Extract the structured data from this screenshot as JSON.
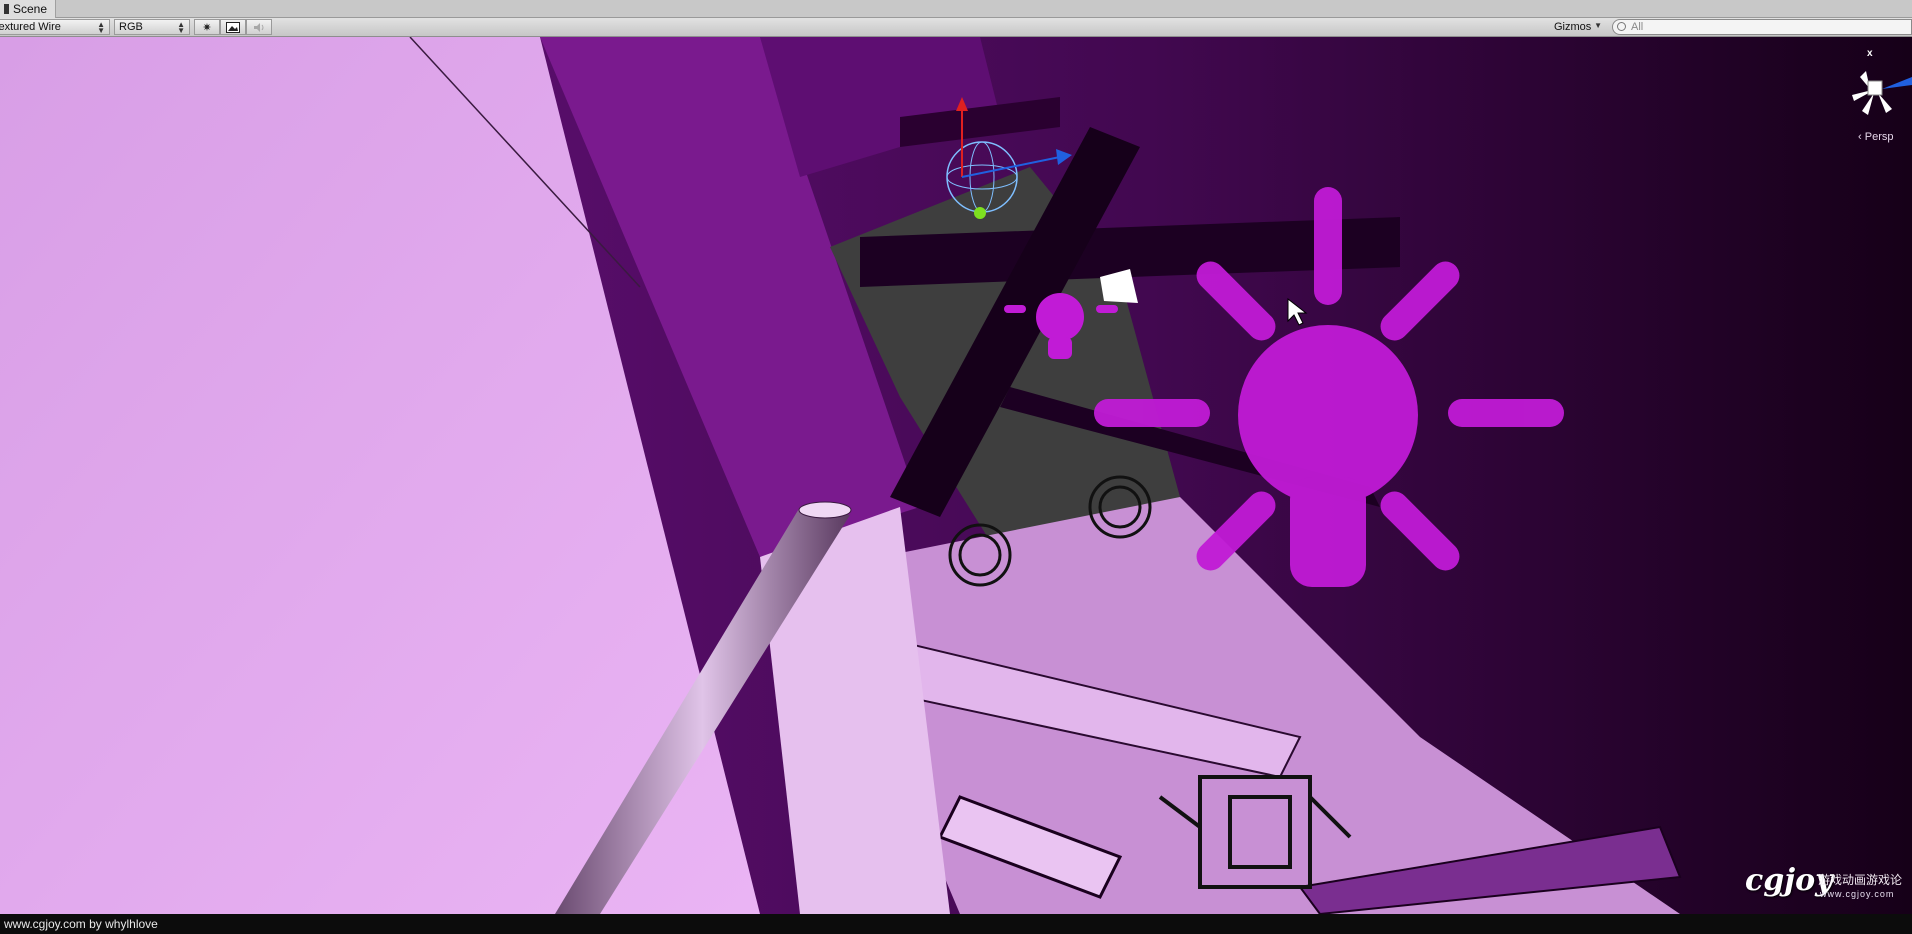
{
  "window": {
    "tab_title": "Scene"
  },
  "toolbar": {
    "render_mode": "Textured Wire",
    "color_mode": "RGB",
    "lighting_icon": "sun-icon",
    "image_icon": "image-icon",
    "audio_icon": "speaker-icon",
    "gizmos_label": "Gizmos",
    "search_placeholder": "All"
  },
  "viewport": {
    "projection_label": "Persp",
    "gizmo_axis": "x",
    "light_icon": "light-bulb-icon",
    "colors": {
      "wall_light": "#e3a8f0",
      "wall_dark": "#5a0a6a",
      "background_dark": "#1a0020",
      "light_gizmo": "#c11bd6"
    }
  },
  "watermark": {
    "logo": "cgjoy",
    "chinese_text": "游戏动画游戏论",
    "url": "www.cgjoy.com"
  },
  "statusbar": {
    "text": "www.cgjoy.com by whylhlove"
  }
}
